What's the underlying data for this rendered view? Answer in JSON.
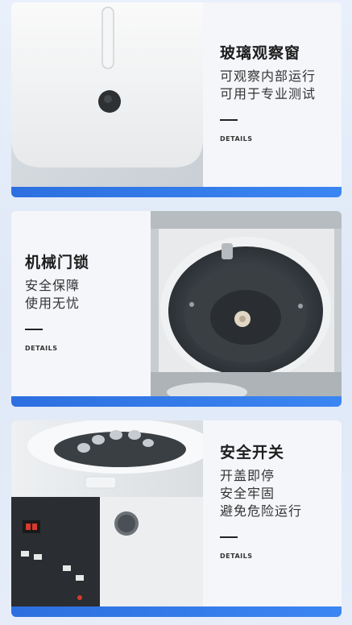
{
  "panels": [
    {
      "title": "玻璃观察窗",
      "lines": [
        "可观察内部运行",
        "可用于专业测试"
      ],
      "details": "DETAILS"
    },
    {
      "title": "机械门锁",
      "lines": [
        "安全保障",
        "使用无忧"
      ],
      "details": "DETAILS"
    },
    {
      "title": "安全开关",
      "lines": [
        "开盖即停",
        "安全牢固",
        "避免危险运行"
      ],
      "details": "DETAILS"
    }
  ],
  "colors": {
    "accent_bar": "#2d6fe0",
    "background": "#e6edf9"
  }
}
